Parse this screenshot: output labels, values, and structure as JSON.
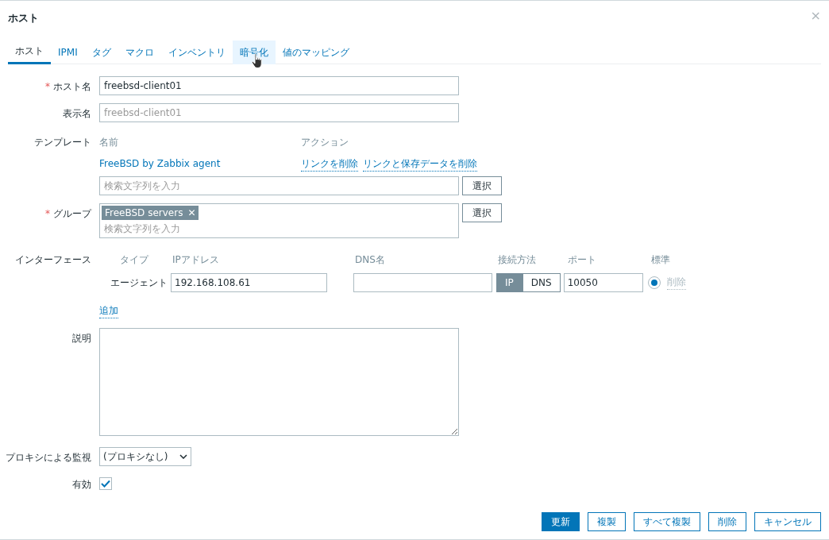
{
  "dialog": {
    "title": "ホスト",
    "close": "×"
  },
  "tabs": [
    {
      "label": "ホスト",
      "selected": true,
      "hovered": false
    },
    {
      "label": "IPMI",
      "selected": false,
      "hovered": false
    },
    {
      "label": "タグ",
      "selected": false,
      "hovered": false
    },
    {
      "label": "マクロ",
      "selected": false,
      "hovered": false
    },
    {
      "label": "インベントリ",
      "selected": false,
      "hovered": false
    },
    {
      "label": "暗号化",
      "selected": false,
      "hovered": true
    },
    {
      "label": "値のマッピング",
      "selected": false,
      "hovered": false
    }
  ],
  "host_name": {
    "label": "ホスト名",
    "required_mark": "*",
    "value": "freebsd-client01"
  },
  "visible_name": {
    "label": "表示名",
    "placeholder": "freebsd-client01"
  },
  "templates": {
    "label": "テンプレート",
    "col_name": "名前",
    "col_action": "アクション",
    "rows": [
      {
        "name": "FreeBSD by Zabbix agent",
        "actions": [
          "リンクを削除",
          "リンクと保存データを削除"
        ]
      }
    ],
    "search_placeholder": "検索文字列を入力",
    "select": "選択"
  },
  "groups": {
    "label": "グループ",
    "required_mark": "*",
    "tags": [
      {
        "label": "FreeBSD servers",
        "remove": "✕"
      }
    ],
    "search_placeholder": "検索文字列を入力",
    "select": "選択"
  },
  "interfaces": {
    "label": "インターフェース",
    "columns": [
      "タイプ",
      "IPアドレス",
      "DNS名",
      "接続方法",
      "ポート",
      "標準"
    ],
    "rows": [
      {
        "type": "エージェント",
        "ip": "192.168.108.61",
        "dns": "",
        "connect": [
          {
            "label": "IP",
            "selected": true
          },
          {
            "label": "DNS",
            "selected": false
          }
        ],
        "port": "10050",
        "default": true,
        "remove": "削除"
      }
    ],
    "add": "追加"
  },
  "description": {
    "label": "説明"
  },
  "proxy": {
    "label": "プロキシによる監視",
    "value": "(プロキシなし)"
  },
  "enabled": {
    "label": "有効",
    "checked": true
  },
  "buttons": [
    {
      "label": "更新",
      "primary": true
    },
    {
      "label": "複製",
      "primary": false
    },
    {
      "label": "すべて複製",
      "primary": false
    },
    {
      "label": "削除",
      "primary": false
    },
    {
      "label": "キャンセル",
      "primary": false
    }
  ]
}
